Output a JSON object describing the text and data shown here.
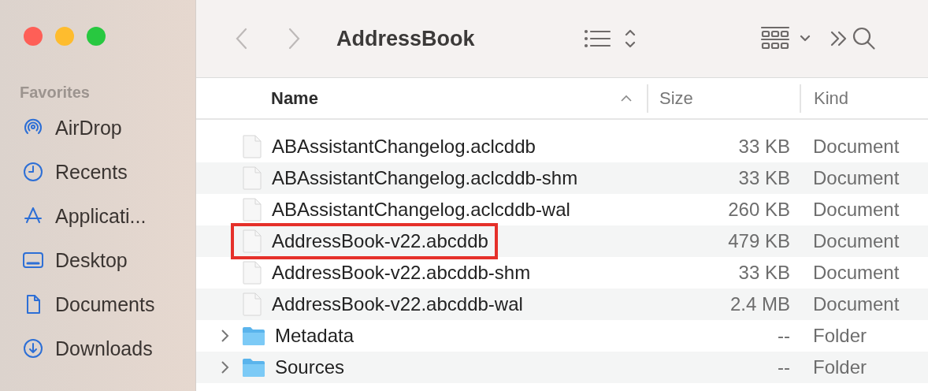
{
  "window": {
    "title": "AddressBook"
  },
  "sidebar": {
    "section": "Favorites",
    "items": [
      {
        "label": "AirDrop"
      },
      {
        "label": "Recents"
      },
      {
        "label": "Applicati..."
      },
      {
        "label": "Desktop"
      },
      {
        "label": "Documents"
      },
      {
        "label": "Downloads"
      }
    ]
  },
  "table": {
    "columns": [
      {
        "label": "Name",
        "sorted": true
      },
      {
        "label": "Size",
        "sorted": false
      },
      {
        "label": "Kind",
        "sorted": false
      }
    ],
    "rows": [
      {
        "kind": "file",
        "name": "ABAssistantChangelog.aclcddb",
        "size": "33 KB",
        "type": "Document",
        "highlighted": false
      },
      {
        "kind": "file",
        "name": "ABAssistantChangelog.aclcddb-shm",
        "size": "33 KB",
        "type": "Document",
        "highlighted": false
      },
      {
        "kind": "file",
        "name": "ABAssistantChangelog.aclcddb-wal",
        "size": "260 KB",
        "type": "Document",
        "highlighted": false
      },
      {
        "kind": "file",
        "name": "AddressBook-v22.abcddb",
        "size": "479 KB",
        "type": "Document",
        "highlighted": true
      },
      {
        "kind": "file",
        "name": "AddressBook-v22.abcddb-shm",
        "size": "33 KB",
        "type": "Document",
        "highlighted": false
      },
      {
        "kind": "file",
        "name": "AddressBook-v22.abcddb-wal",
        "size": "2.4 MB",
        "type": "Document",
        "highlighted": false
      },
      {
        "kind": "folder",
        "name": "Metadata",
        "size": "--",
        "type": "Folder",
        "expanded": false,
        "highlighted": false
      },
      {
        "kind": "folder",
        "name": "Sources",
        "size": "--",
        "type": "Folder",
        "expanded": false,
        "highlighted": false
      }
    ]
  }
}
